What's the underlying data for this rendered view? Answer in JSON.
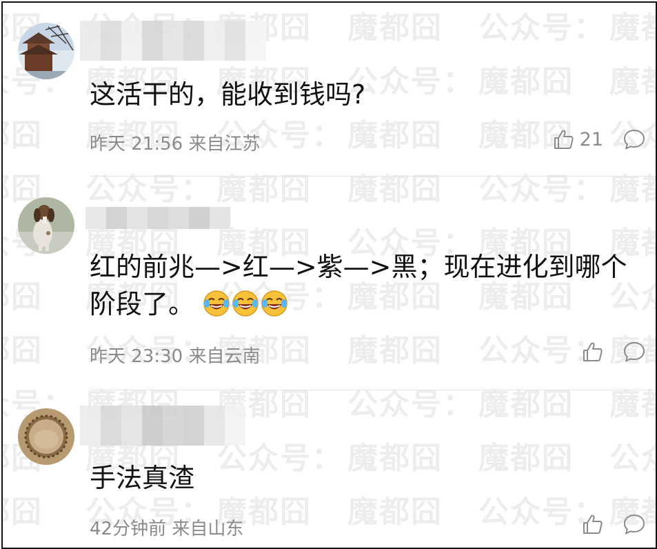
{
  "watermark": {
    "text_a": "魔都囧",
    "text_b": "公众号："
  },
  "comments": [
    {
      "text": "这活干的，能收到钱吗?",
      "time": "昨天 21:56",
      "location": "来自江苏",
      "likes": "21",
      "avatar": "pagoda-tree-avatar"
    },
    {
      "text": "红的前兆—>红—>紫—>黑；现在进化到哪个阶段了。",
      "emojis": [
        "laugh-cry-emoji",
        "laugh-cry-emoji",
        "laugh-cry-emoji"
      ],
      "time": "昨天 23:30",
      "location": "来自云南",
      "likes": "",
      "avatar": "dog-avatar"
    },
    {
      "text": "手法真渣",
      "time": "42分钟前",
      "location": "来自山东",
      "likes": "",
      "avatar": "crater-avatar"
    }
  ],
  "icons": {
    "like": "thumbs-up-icon",
    "reply": "comment-bubble-icon"
  },
  "colors": {
    "meta": "#8a8a8a",
    "text": "#111111",
    "divider": "#e4e4e4"
  }
}
